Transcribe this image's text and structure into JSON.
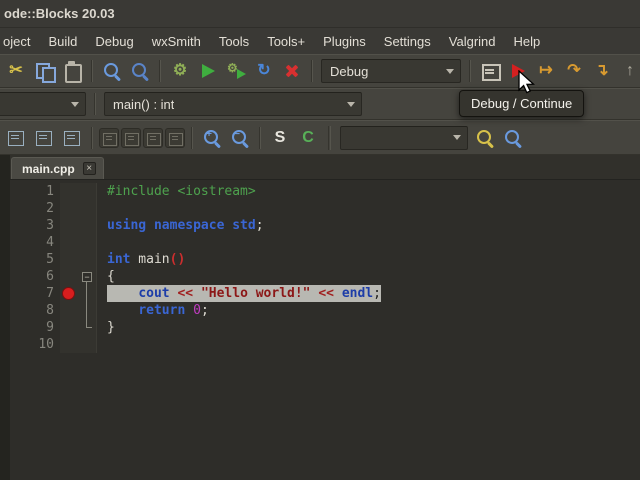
{
  "window": {
    "title": "ode::Blocks 20.03"
  },
  "menu": {
    "items": [
      "oject",
      "Build",
      "Debug",
      "wxSmith",
      "Tools",
      "Tools+",
      "Plugins",
      "Settings",
      "Valgrind",
      "Help"
    ]
  },
  "toolbars": {
    "main": [
      {
        "type": "btn",
        "name": "cut-button",
        "icon": "glyph",
        "glyph": "✂",
        "color": "#d8c24a"
      },
      {
        "type": "btn",
        "name": "copy-button",
        "icon": "copy",
        "color": "#86a8dc"
      },
      {
        "type": "btn",
        "name": "paste-button",
        "icon": "paste",
        "color": "#b8b4a8"
      },
      {
        "type": "sep"
      },
      {
        "type": "btn",
        "name": "find-button",
        "icon": "magnifier",
        "color": "#6a9ade"
      },
      {
        "type": "btn",
        "name": "find-in-files-button",
        "icon": "magnifier",
        "color": "#5a84c8"
      },
      {
        "type": "sep"
      },
      {
        "type": "btn",
        "name": "build-button",
        "icon": "glyph",
        "glyph": "⚙",
        "color": "#8fae56"
      },
      {
        "type": "btn",
        "name": "run-button",
        "icon": "play",
        "color": "#3fae3f"
      },
      {
        "type": "btn",
        "name": "build-and-run-button",
        "icon": "gearplay",
        "glyph": "⚙",
        "color": "#8fae56"
      },
      {
        "type": "btn",
        "name": "rebuild-button",
        "icon": "glyph",
        "glyph": "↻",
        "color": "#4a86d8"
      },
      {
        "type": "btn",
        "name": "abort-button",
        "icon": "x",
        "color": "#d83030"
      },
      {
        "type": "sep"
      },
      {
        "type": "combo",
        "name": "build-target-combobox",
        "value": "Debug",
        "width": 140
      },
      {
        "type": "sep"
      },
      {
        "type": "btn",
        "name": "debugging-windows-button",
        "icon": "window",
        "color": "#c8c4b8"
      },
      {
        "type": "btn",
        "name": "debug-continue-button",
        "icon": "play",
        "color": "#d42020"
      },
      {
        "type": "btn",
        "name": "run-to-cursor-button",
        "icon": "glyph",
        "glyph": "↦",
        "color": "#d89a30"
      },
      {
        "type": "btn",
        "name": "next-line-button",
        "icon": "glyph",
        "glyph": "↷",
        "color": "#d89a30"
      },
      {
        "type": "btn",
        "name": "step-into-button",
        "icon": "glyph",
        "glyph": "↴",
        "color": "#d89a30"
      },
      {
        "type": "btn",
        "name": "step-out-button",
        "icon": "glyph",
        "glyph": "↑",
        "color": "#b0ac9f"
      }
    ],
    "code": [
      {
        "type": "btn",
        "name": "swap-header-source-button",
        "icon": "frame",
        "color": "#9ab0c0"
      },
      {
        "type": "btn",
        "name": "goto-declaration-button",
        "icon": "frame",
        "color": "#9ab0c0"
      },
      {
        "type": "btn",
        "name": "goto-implementation-button",
        "icon": "frame",
        "color": "#9ab0c0"
      },
      {
        "type": "sep"
      },
      {
        "type": "btn",
        "name": "fold-all-button",
        "icon": "frame2",
        "dark": true
      },
      {
        "type": "btn",
        "name": "unfold-all-button",
        "icon": "frame2",
        "dark": true
      },
      {
        "type": "btn",
        "name": "prev-bookmark-button",
        "icon": "frame2",
        "dark": true
      },
      {
        "type": "btn",
        "name": "next-bookmark-button",
        "icon": "frame2",
        "dark": true
      },
      {
        "type": "sep"
      },
      {
        "type": "btn",
        "name": "zoom-in-button",
        "icon": "magnifier",
        "glyph": "+",
        "color": "#6a9ade"
      },
      {
        "type": "btn",
        "name": "zoom-out-button",
        "icon": "magnifier",
        "glyph": "−",
        "color": "#6a9ade"
      },
      {
        "type": "sep"
      },
      {
        "type": "btn",
        "name": "insert-snippet-button",
        "icon": "glyph",
        "glyph": "S",
        "color": "#e8e6de"
      },
      {
        "type": "btn",
        "name": "comment-button",
        "icon": "glyph",
        "glyph": "C",
        "color": "#58b058"
      },
      {
        "type": "sep2"
      },
      {
        "type": "combo",
        "name": "incremental-search-combobox",
        "value": "",
        "width": 128
      },
      {
        "type": "btn",
        "name": "highlight-occurrences-button",
        "icon": "magnifier",
        "color": "#d8c24a"
      },
      {
        "type": "btn",
        "name": "incremental-search-button",
        "icon": "magnifier",
        "color": "#6a9ade"
      }
    ]
  },
  "symbols": {
    "scope_value": "",
    "function_value": "main() : int"
  },
  "tabs": [
    {
      "label": "main.cpp",
      "active": true
    }
  ],
  "tooltip": "Debug / Continue",
  "editor": {
    "active_line": 7,
    "breakpoint_line": 7,
    "colors": {
      "breakpoint": "#d81e1e",
      "active_line_bg": "#b8b8b2",
      "background": "#2e2d29"
    },
    "token_colors": {
      "pp": "#4ea24e",
      "kw": "#3a66d4",
      "op": "#cc2e2e",
      "str": "#a82424",
      "num": "#c13cc1",
      "pl": "#dedbd2"
    },
    "lines": [
      {
        "num": 1,
        "segments": [
          {
            "t": "#include <iostream>",
            "c": "pp"
          }
        ]
      },
      {
        "num": 2,
        "segments": []
      },
      {
        "num": 3,
        "segments": [
          {
            "t": "using namespace std",
            "c": "kw"
          },
          {
            "t": ";",
            "c": "pl"
          }
        ]
      },
      {
        "num": 4,
        "segments": []
      },
      {
        "num": 5,
        "segments": [
          {
            "t": "int",
            "c": "kw"
          },
          {
            "t": " main",
            "c": "pl"
          },
          {
            "t": "()",
            "c": "op"
          }
        ]
      },
      {
        "num": 6,
        "fold": "open",
        "segments": [
          {
            "t": "{",
            "c": "pl"
          }
        ]
      },
      {
        "num": 7,
        "fold": "line",
        "segments": [
          {
            "t": "    ",
            "c": "pl"
          },
          {
            "t": "cout",
            "c": "kw"
          },
          {
            "t": " ",
            "c": "pl"
          },
          {
            "t": "<<",
            "c": "op"
          },
          {
            "t": " ",
            "c": "pl"
          },
          {
            "t": "\"Hello world!\"",
            "c": "str"
          },
          {
            "t": " ",
            "c": "pl"
          },
          {
            "t": "<<",
            "c": "op"
          },
          {
            "t": " ",
            "c": "pl"
          },
          {
            "t": "endl",
            "c": "kw"
          },
          {
            "t": ";",
            "c": "pl"
          }
        ]
      },
      {
        "num": 8,
        "fold": "line",
        "segments": [
          {
            "t": "    ",
            "c": "pl"
          },
          {
            "t": "return",
            "c": "kw"
          },
          {
            "t": " ",
            "c": "pl"
          },
          {
            "t": "0",
            "c": "num"
          },
          {
            "t": ";",
            "c": "pl"
          }
        ]
      },
      {
        "num": 9,
        "fold": "end",
        "segments": [
          {
            "t": "}",
            "c": "pl"
          }
        ]
      },
      {
        "num": 10,
        "segments": []
      }
    ]
  }
}
